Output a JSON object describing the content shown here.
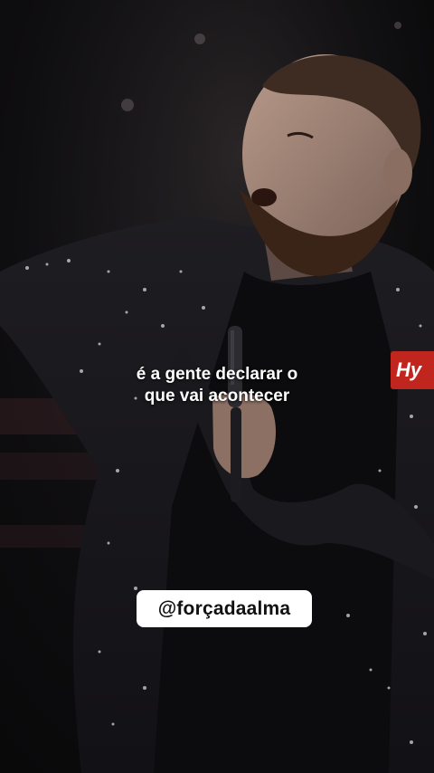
{
  "video": {
    "caption_lines": [
      "é a gente declarar o",
      "que vai acontecer"
    ],
    "shirt_logo_text": "Hy"
  },
  "overlay": {
    "handle": "@forçadaalma"
  },
  "colors": {
    "background": "#0b0b0d",
    "badge_background": "#ffffff",
    "badge_text": "#111111",
    "caption_text": "#ffffff",
    "logo_red": "#c1261e"
  },
  "icons": [
    "microphone-icon"
  ]
}
